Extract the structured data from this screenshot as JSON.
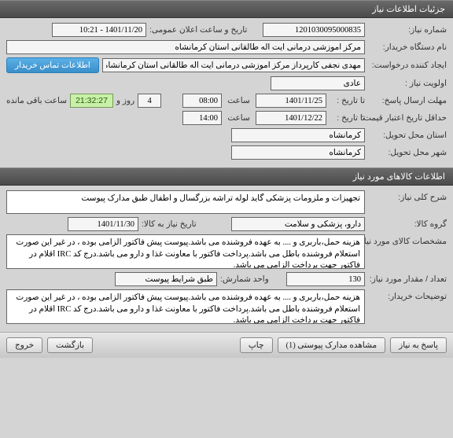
{
  "sections": {
    "need_info": "جزئیات اطلاعات نیاز",
    "goods_info": "اطلاعات کالاهای مورد نیاز"
  },
  "labels": {
    "need_no": "شماره نیاز:",
    "announce_dt": "تاریخ و ساعت اعلان عمومی:",
    "buyer_org": "نام دستگاه خریدار:",
    "requester": "ایجاد کننده درخواست:",
    "contact_btn": "اطلاعات تماس خریدار",
    "priority": "اولویت نیاز :",
    "reply_deadline": "مهلت ارسال پاسخ:",
    "to_date": "تا تاریخ :",
    "time": "ساعت",
    "days_and": "روز و",
    "remaining": "ساعت باقی مانده",
    "valid_min": "حداقل تاریخ اعتبار قیمت:",
    "delivery_prov": "استان محل تحویل:",
    "delivery_city": "شهر محل تحویل:",
    "desc_title": "شرح کلی نیاز:",
    "goods_group": "گروه کالا:",
    "need_date": "تاریخ نیاز به کالا:",
    "goods_spec": "مشخصات کالای مورد نیاز:",
    "qty": "تعداد / مقدار مورد نیاز:",
    "unit": "واحد شمارش:",
    "buyer_notes": "توضیحات خریدار:"
  },
  "values": {
    "need_no": "1201030095000835",
    "announce_dt": "1401/11/20 - 10:21",
    "buyer_org": "مرکز اموزشی درمانی ایت اله طالقانی استان کرمانشاه",
    "requester": "مهدی نجفی کارپرداز مرکز اموزشی درمانی ایت اله طالقانی استان کرمانشاه",
    "priority": "عادی",
    "reply_date": "1401/11/25",
    "reply_time": "08:00",
    "days": "4",
    "timer": "21:32:27",
    "valid_date": "1401/12/22",
    "valid_time": "14:00",
    "province": "کرمانشاه",
    "city": "کرمانشاه",
    "desc": "تجهیزات و ملزومات پزشکی گاید لوله تراشه بزرگسال و اطفال طبق مدارک پیوست",
    "goods_group": "دارو، پزشکی و سلامت",
    "need_date": "1401/11/30",
    "spec": "هزینه حمل،باربری و .... به عهده فروشنده می باشد.پیوست پیش فاکتور الزامی بوده ، در غیر این صورت استعلام فروشنده باطل می باشد.پرداخت فاکتور با معاونت غذا و دارو می باشد.درج کد IRC اقلام در فاکتور جهت پرداخت الزامی می باشد.",
    "qty": "130",
    "unit": "طبق شرایط پیوست",
    "notes": "هزینه حمل،باربری و .... به عهده فروشنده می باشد.پیوست پیش فاکتور الزامی بوده ، در غیر این صورت استعلام فروشنده باطل می باشد.پرداخت فاکتور با معاونت غذا و دارو می باشد.درج کد IRC اقلام در فاکتور جهت پرداخت الزامی می باشد."
  },
  "footer": {
    "reply": "پاسخ به نیاز",
    "attachments": "مشاهده مدارک پیوستی (1)",
    "print": "چاپ",
    "back": "بازگشت",
    "exit": "خروج"
  }
}
